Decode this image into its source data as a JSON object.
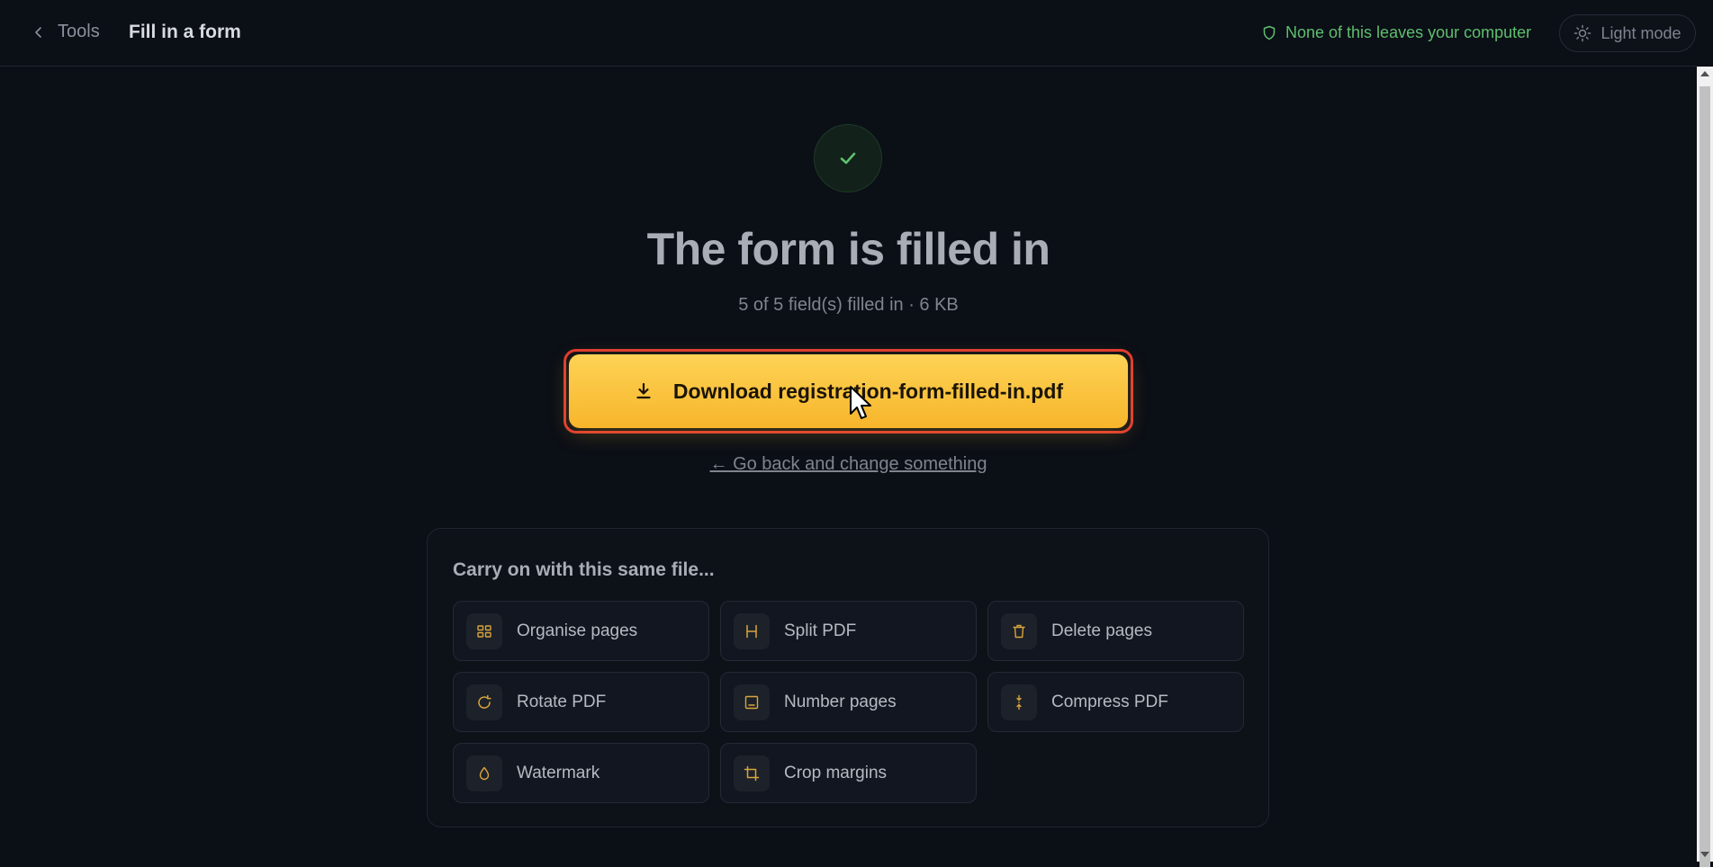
{
  "header": {
    "back_label": "Tools",
    "page_title": "Fill in a form",
    "privacy_note": "None of this leaves your computer",
    "theme_toggle_label": "Light mode"
  },
  "result": {
    "headline": "The form is filled in",
    "summary": "5 of 5 field(s) filled in · 6 KB",
    "download_label": "Download registration-form-filled-in.pdf",
    "go_back_label": "← Go back and change something"
  },
  "carry_on": {
    "title": "Carry on with this same file...",
    "tools": [
      {
        "label": "Organise pages",
        "icon": "grid-icon"
      },
      {
        "label": "Split PDF",
        "icon": "split-icon"
      },
      {
        "label": "Delete pages",
        "icon": "trash-icon"
      },
      {
        "label": "Rotate PDF",
        "icon": "rotate-icon"
      },
      {
        "label": "Number pages",
        "icon": "page-number-icon"
      },
      {
        "label": "Compress PDF",
        "icon": "compress-icon"
      },
      {
        "label": "Watermark",
        "icon": "droplet-icon"
      },
      {
        "label": "Crop margins",
        "icon": "crop-icon"
      }
    ]
  },
  "colors": {
    "background": "#0b0f16",
    "accent": "#f7b52b",
    "success": "#5fbf6e",
    "highlight_border": "#e03a30"
  }
}
